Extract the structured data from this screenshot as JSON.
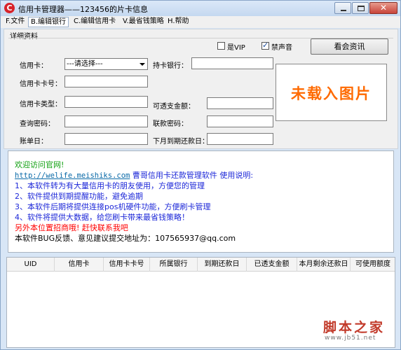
{
  "window": {
    "title": "信用卡管理器——123456的片卡信息",
    "controls": {
      "minimize_icon": "minimize-icon",
      "maximize_icon": "maximize-icon",
      "close_icon": "close-icon",
      "close_glyph": "✕"
    }
  },
  "menu": {
    "items": [
      "F.文件",
      "B.编辑银行",
      "C.编辑信用卡",
      "V.最省钱策略",
      "H.帮助"
    ],
    "active_index": 1
  },
  "details": {
    "group_label": "详细资料",
    "vip_label": "是VIP",
    "vip_checked": false,
    "mute_label": "禁声音",
    "mute_checked": true,
    "ad_button": "看会资讯",
    "fields": {
      "card_label": "信用卡：",
      "card_select": "---请选择---",
      "bank_label": "持卡银行：",
      "card_number_label": "信用卡卡号：",
      "card_type_label": "信用卡类型：",
      "overdraft_label": "可透支金额：",
      "query_pwd_label": "查询密码：",
      "trade_pwd_label": "联款密码：",
      "bill_day_label": "账单日：",
      "next_due_label": "下月到期还款日："
    },
    "image_placeholder": "未载入图片"
  },
  "info": {
    "welcome": "欢迎访问官网!",
    "url": "http://welife.meishiks.com",
    "intro": "曹哥信用卡还款管理软件 使用说明:",
    "tips": [
      "1、本软件转为有大量信用卡的朋友使用，方便您的管理",
      "2、软件提供到期提醒功能，避免逾期",
      "3、本软件后期将提供连接pos机硬件功能，方便刷卡管理",
      "4、软件将提供大数据，给您刷卡带来最省钱策略！"
    ],
    "promo": "另外本位置招商哦! 赶快联系我吧",
    "feedback": "本软件BUG反馈、意见建议提交地址为：107565937@qq.com"
  },
  "table": {
    "columns": [
      "UID",
      "信用卡",
      "信用卡卡号",
      "所属银行",
      "到期还款日",
      "已透支金额",
      "本月剩余还款日",
      "可使用额度"
    ],
    "rows": []
  },
  "watermark": {
    "top": "脚本之家",
    "bottom": "www.jb51.net"
  },
  "colors": {
    "accent_orange": "#ff6a00",
    "tip_blue": "#1c27d8",
    "welcome_green": "#10a010",
    "promo_red": "#ff0000"
  }
}
